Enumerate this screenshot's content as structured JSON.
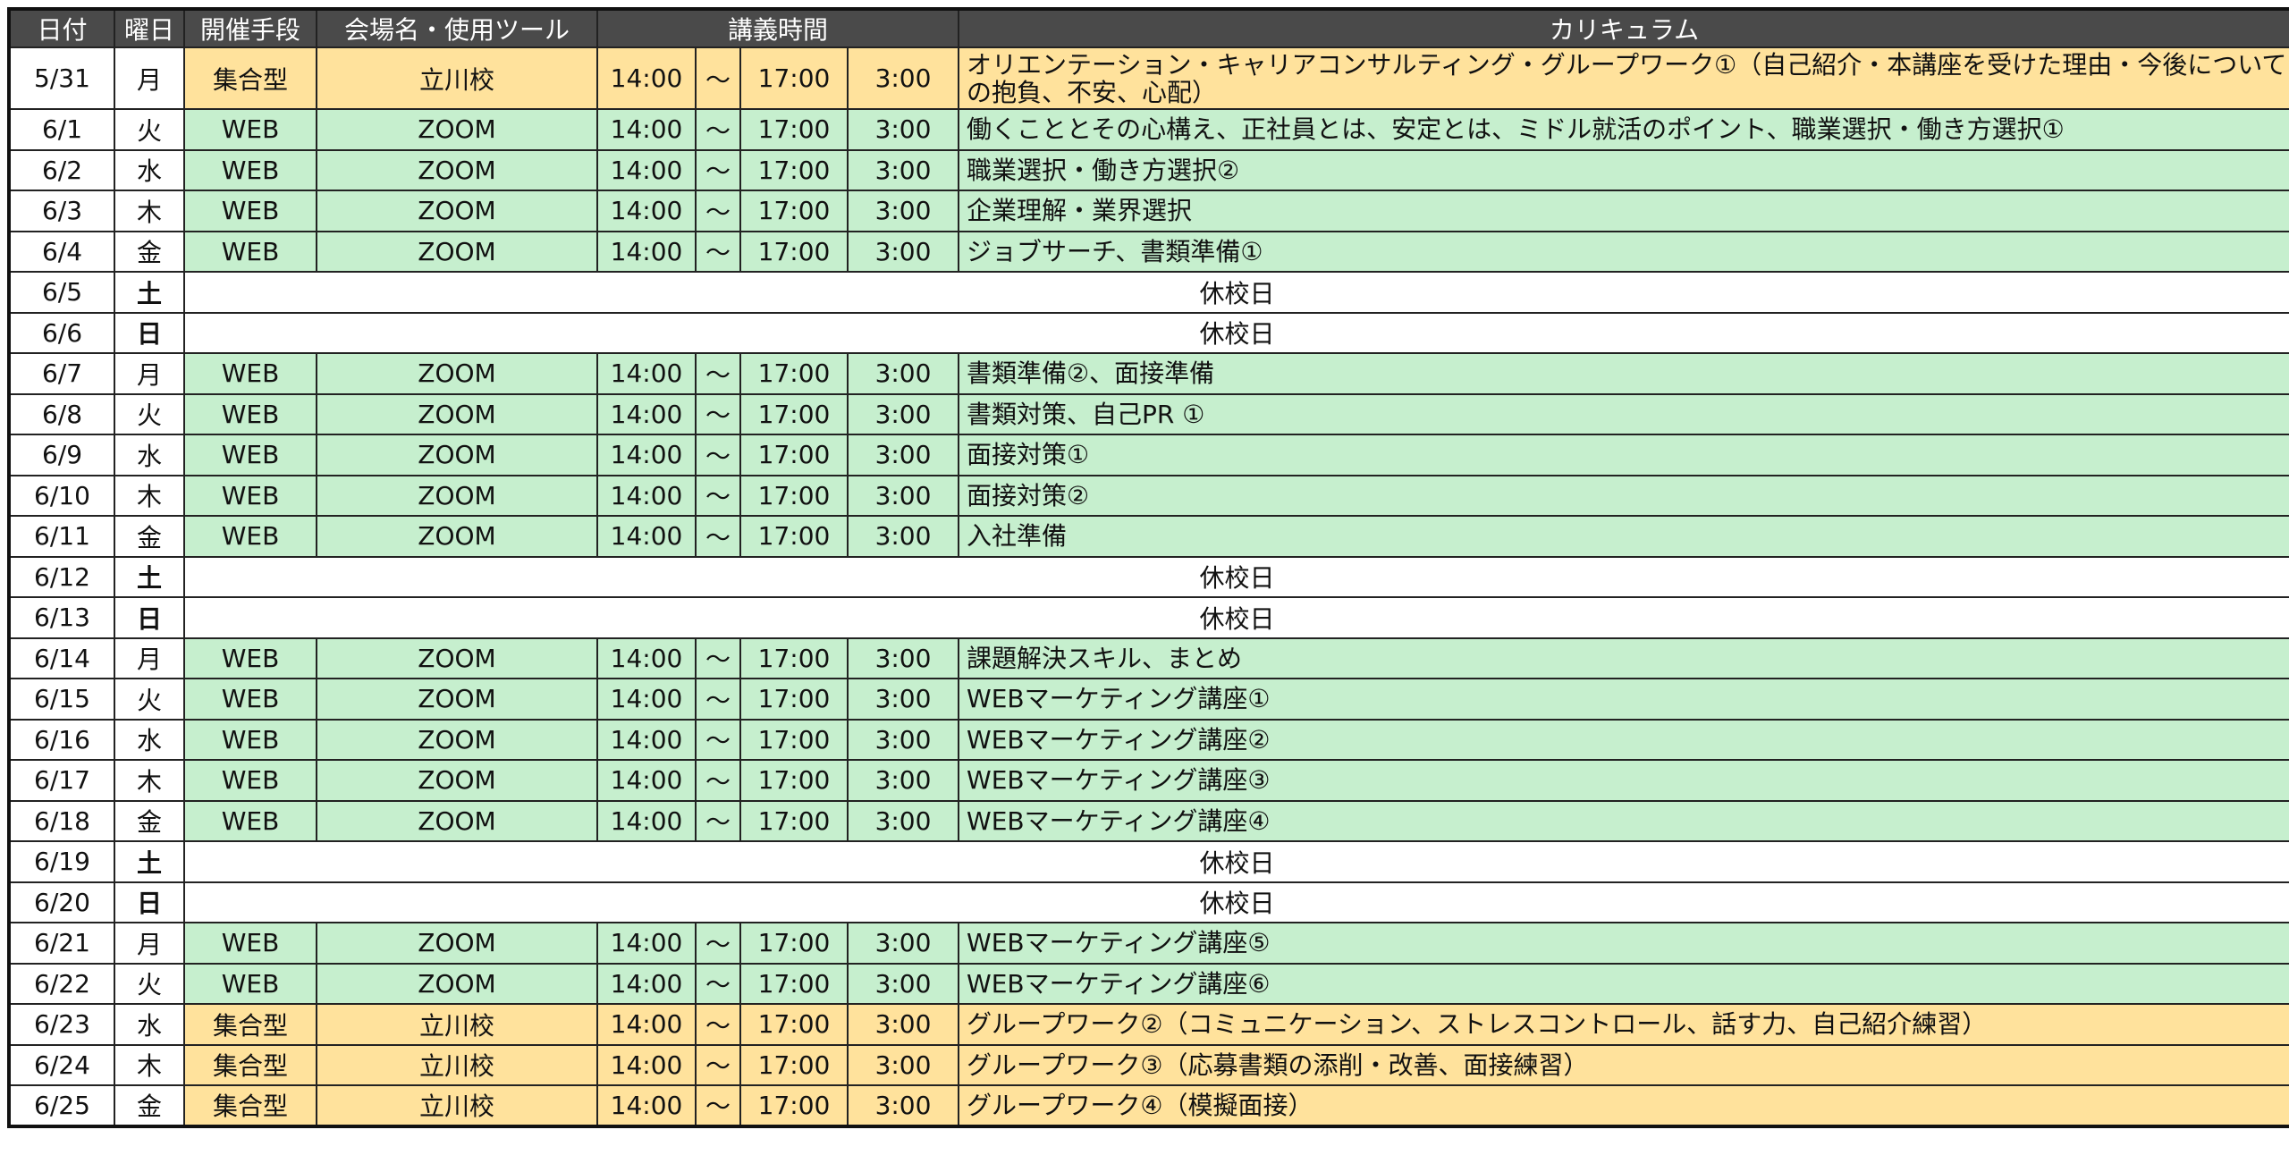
{
  "header": {
    "date": "日付",
    "day": "曜日",
    "mode": "開催手段",
    "venue": "会場名・使用ツール",
    "time": "講義時間",
    "curriculum": "カリキュラム"
  },
  "common": {
    "start": "14:00",
    "tilde": "～",
    "end": "17:00",
    "duration": "3:00",
    "holiday": "休校日"
  },
  "colors": {
    "header_bg": "#4a4a4a",
    "web_bg": "#c6efce",
    "web_text": "#1e7a1e",
    "group_bg": "#ffe29c",
    "group_text": "#9c6500",
    "saturday": "#1010d0",
    "sunday": "#e01010",
    "marketing_text": "#1010d0"
  },
  "rows": [
    {
      "date": "5/31",
      "dow": "月",
      "type": "group",
      "mode": "集合型",
      "venue": "立川校",
      "curriculum": "オリエンテーション・キャリアコンサルティング・グループワーク①（自己紹介・本講座を受けた理由・今後についての抱負、不安、心配）"
    },
    {
      "date": "6/1",
      "dow": "火",
      "type": "web",
      "mode": "WEB",
      "venue": "ZOOM",
      "curriculum": "働くこととその心構え、正社員とは、安定とは、ミドル就活のポイント、職業選択・働き方選択①"
    },
    {
      "date": "6/2",
      "dow": "水",
      "type": "web",
      "mode": "WEB",
      "venue": "ZOOM",
      "curriculum": "職業選択・働き方選択②"
    },
    {
      "date": "6/3",
      "dow": "木",
      "type": "web",
      "mode": "WEB",
      "venue": "ZOOM",
      "curriculum": "企業理解・業界選択"
    },
    {
      "date": "6/4",
      "dow": "金",
      "type": "web",
      "mode": "WEB",
      "venue": "ZOOM",
      "curriculum": "ジョブサーチ、書類準備①"
    },
    {
      "date": "6/5",
      "dow": "土",
      "type": "holiday"
    },
    {
      "date": "6/6",
      "dow": "日",
      "type": "holiday"
    },
    {
      "date": "6/7",
      "dow": "月",
      "type": "web",
      "mode": "WEB",
      "venue": "ZOOM",
      "curriculum": "書類準備②、面接準備"
    },
    {
      "date": "6/8",
      "dow": "火",
      "type": "web",
      "mode": "WEB",
      "venue": "ZOOM",
      "curriculum": "書類対策、自己PR ①"
    },
    {
      "date": "6/9",
      "dow": "水",
      "type": "web",
      "mode": "WEB",
      "venue": "ZOOM",
      "curriculum": "面接対策①"
    },
    {
      "date": "6/10",
      "dow": "木",
      "type": "web",
      "mode": "WEB",
      "venue": "ZOOM",
      "curriculum": "面接対策②"
    },
    {
      "date": "6/11",
      "dow": "金",
      "type": "web",
      "mode": "WEB",
      "venue": "ZOOM",
      "curriculum": "入社準備"
    },
    {
      "date": "6/12",
      "dow": "土",
      "type": "holiday"
    },
    {
      "date": "6/13",
      "dow": "日",
      "type": "holiday"
    },
    {
      "date": "6/14",
      "dow": "月",
      "type": "web",
      "mode": "WEB",
      "venue": "ZOOM",
      "curriculum": "課題解決スキル、まとめ"
    },
    {
      "date": "6/15",
      "dow": "火",
      "type": "web",
      "mode": "WEB",
      "venue": "ZOOM",
      "curriculum": "WEBマーケティング講座①",
      "highlight": true
    },
    {
      "date": "6/16",
      "dow": "水",
      "type": "web",
      "mode": "WEB",
      "venue": "ZOOM",
      "curriculum": "WEBマーケティング講座②",
      "highlight": true
    },
    {
      "date": "6/17",
      "dow": "木",
      "type": "web",
      "mode": "WEB",
      "venue": "ZOOM",
      "curriculum": "WEBマーケティング講座③",
      "highlight": true
    },
    {
      "date": "6/18",
      "dow": "金",
      "type": "web",
      "mode": "WEB",
      "venue": "ZOOM",
      "curriculum": "WEBマーケティング講座④",
      "highlight": true
    },
    {
      "date": "6/19",
      "dow": "土",
      "type": "holiday"
    },
    {
      "date": "6/20",
      "dow": "日",
      "type": "holiday"
    },
    {
      "date": "6/21",
      "dow": "月",
      "type": "web",
      "mode": "WEB",
      "venue": "ZOOM",
      "curriculum": "WEBマーケティング講座⑤",
      "highlight": true
    },
    {
      "date": "6/22",
      "dow": "火",
      "type": "web",
      "mode": "WEB",
      "venue": "ZOOM",
      "curriculum": "WEBマーケティング講座⑥",
      "highlight": true
    },
    {
      "date": "6/23",
      "dow": "水",
      "type": "group",
      "mode": "集合型",
      "venue": "立川校",
      "curriculum": "グループワーク②（コミュニケーション、ストレスコントロール、話す力、自己紹介練習）"
    },
    {
      "date": "6/24",
      "dow": "木",
      "type": "group",
      "mode": "集合型",
      "venue": "立川校",
      "curriculum": "グループワーク③（応募書類の添削・改善、面接練習）"
    },
    {
      "date": "6/25",
      "dow": "金",
      "type": "group",
      "mode": "集合型",
      "venue": "立川校",
      "curriculum": "グループワーク④（模擬面接）"
    }
  ]
}
